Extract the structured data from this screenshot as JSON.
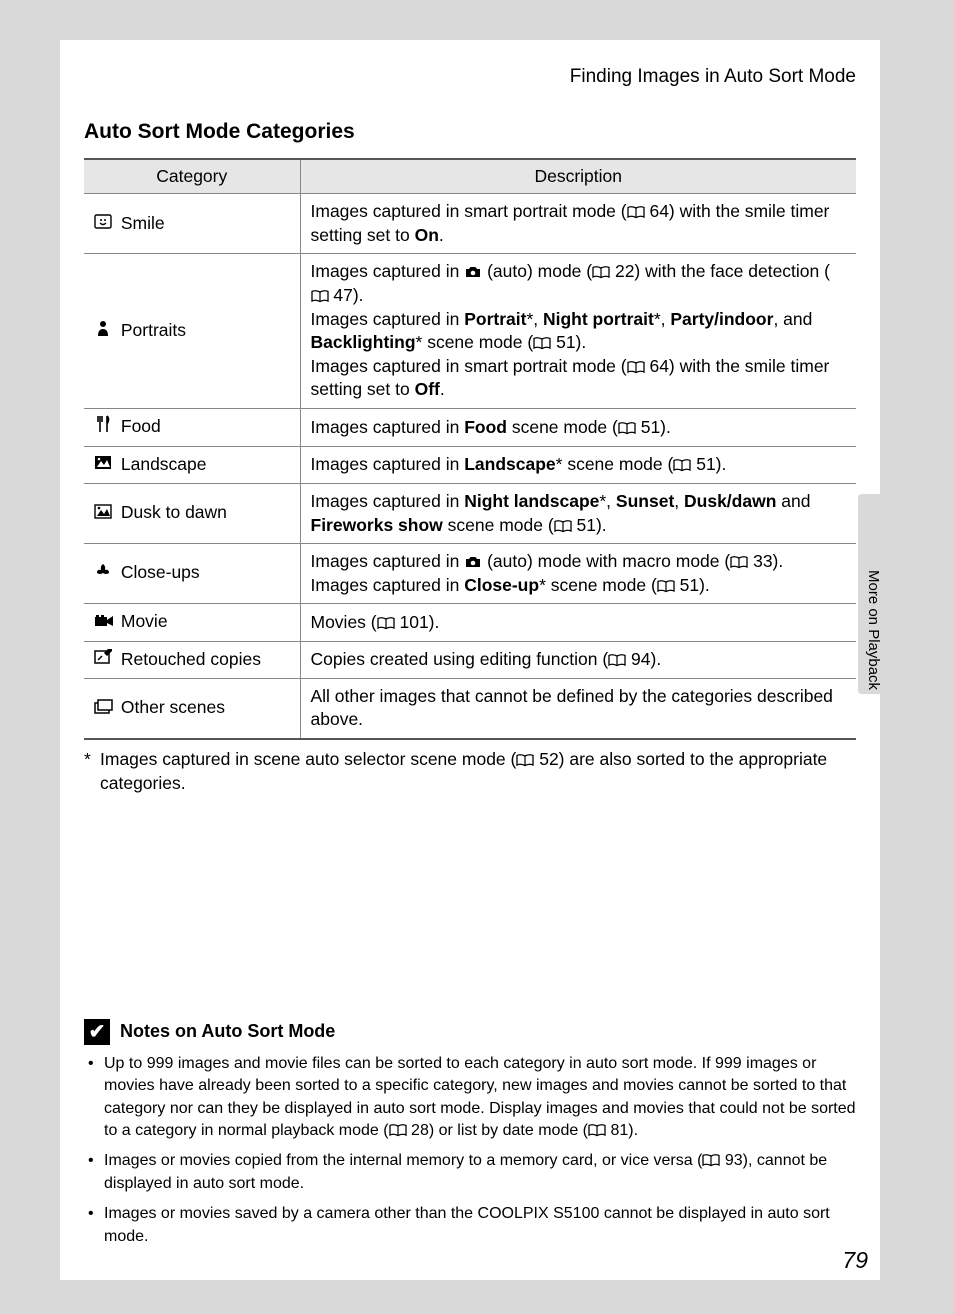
{
  "header": "Finding Images in Auto Sort Mode",
  "section_heading": "Auto Sort Mode Categories",
  "side_section": "More on Playback",
  "page_number": "79",
  "table": {
    "col_category": "Category",
    "col_description": "Description",
    "rows": [
      {
        "icon": "smile",
        "name": "Smile",
        "desc": "Images captured in smart portrait mode ({P} 64) with the smile timer setting set to <b>On</b>."
      },
      {
        "icon": "portrait",
        "name": "Portraits",
        "desc": "Images captured in {CAM} (auto) mode ({P} 22) with the face detection ({P} 47).<br>Images captured in <b>Portrait</b>*, <b>Night portrait</b>*, <b>Party/indoor</b>, and <b>Backlighting</b>* scene mode ({P} 51).<br>Images captured in smart portrait mode ({P} 64) with the smile timer setting set to <b>Off</b>."
      },
      {
        "icon": "food",
        "name": "Food",
        "desc": "Images captured in <b>Food</b> scene mode ({P} 51)."
      },
      {
        "icon": "landscape",
        "name": "Landscape",
        "desc": "Images captured in <b>Landscape</b>* scene mode ({P} 51)."
      },
      {
        "icon": "dusk",
        "name": "Dusk to dawn",
        "desc": "Images captured in <b>Night landscape</b>*, <b>Sunset</b>, <b>Dusk/dawn</b> and <b>Fireworks show</b> scene mode ({P} 51)."
      },
      {
        "icon": "closeup",
        "name": "Close-ups",
        "desc": "Images captured in {CAM} (auto) mode with macro mode ({P} 33).<br>Images captured in <b>Close-up</b>* scene mode ({P} 51)."
      },
      {
        "icon": "movie",
        "name": "Movie",
        "desc": "Movies ({P} 101)."
      },
      {
        "icon": "retouch",
        "name": "Retouched copies",
        "desc": "Copies created using editing function ({P} 94)."
      },
      {
        "icon": "other",
        "name": "Other scenes",
        "desc": "All other images that cannot be defined by the categories described above."
      }
    ]
  },
  "footnote": "Images captured in scene auto selector scene mode ({P} 52) are also sorted to the appropriate categories.",
  "notes_heading": "Notes on Auto Sort Mode",
  "notes": [
    "Up to 999 images and movie files can be sorted to each category in auto sort mode. If 999 images or movies have already been sorted to a specific category, new images and movies cannot be sorted to that category nor can they be displayed in auto sort mode. Display images and movies that could not be sorted to a category in normal playback mode ({P} 28) or list by date mode ({P} 81).",
    "Images or movies copied from the internal memory to a memory card, or vice versa ({P} 93), cannot be displayed in auto sort mode.",
    "Images or movies saved by a camera other than the COOLPIX S5100 cannot be displayed in auto sort mode."
  ]
}
